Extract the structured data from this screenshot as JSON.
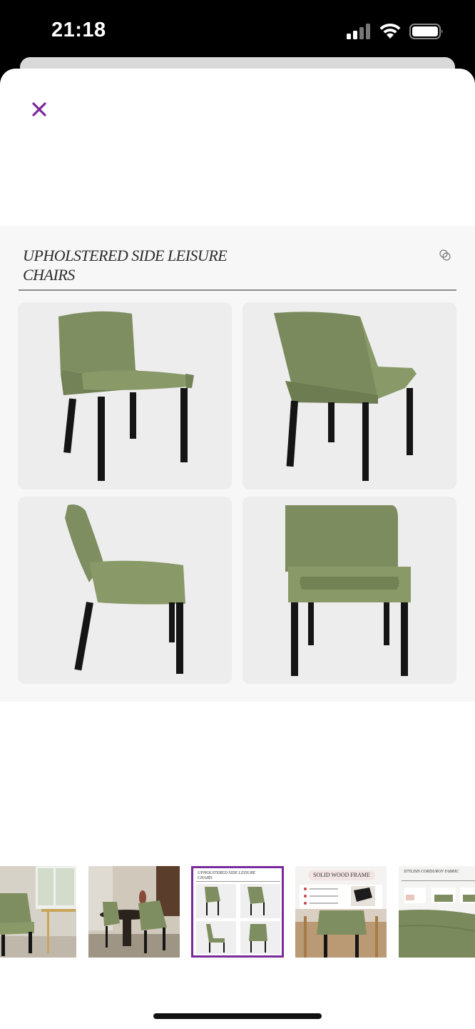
{
  "status_bar": {
    "time": "21:18",
    "icons": [
      "signal-icon",
      "wifi-icon",
      "battery-icon"
    ]
  },
  "viewer": {
    "close_icon": "close-icon",
    "accent_color": "#7a2a9a",
    "main_image": {
      "title": "UPHOLSTERED SIDE LEISURE CHAIRS",
      "views": [
        "front-three-quarter",
        "back-three-quarter",
        "side",
        "front"
      ],
      "chair_color": "#7d8c5e",
      "leg_color": "#1a1a1a"
    },
    "thumbnails": [
      {
        "id": "lifestyle-living-room",
        "text": ""
      },
      {
        "id": "lifestyle-dining-room",
        "text": ""
      },
      {
        "id": "four-views",
        "text": "UPHOLSTERED SIDE LEISURE CHAIRS",
        "selected": true
      },
      {
        "id": "solid-wood-frame",
        "text": "SOLID WOOD FRAME"
      },
      {
        "id": "stylish-corduroy-fabric",
        "text": "STYLISH CORDUROY FABRIC"
      }
    ]
  }
}
